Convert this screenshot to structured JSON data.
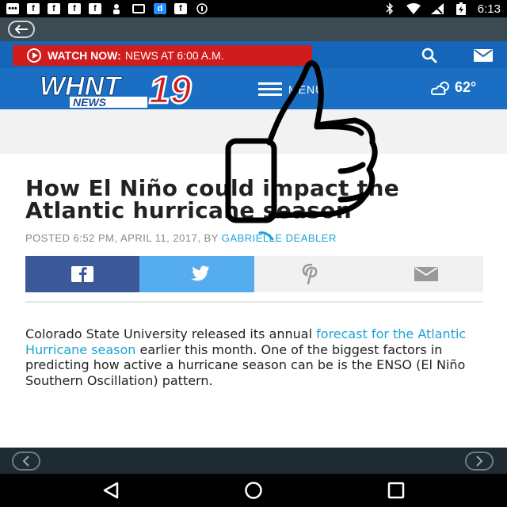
{
  "status_bar": {
    "left_icons": [
      "message-icon",
      "facebook-icon",
      "facebook-icon",
      "facebook-icon",
      "facebook-icon",
      "person-icon",
      "screen-icon",
      "dailymotion-icon",
      "facebook-icon",
      "circle-icon"
    ],
    "time": "6:13"
  },
  "header": {
    "watch_now_label": "WATCH NOW:",
    "watch_now_text": "NEWS AT 6:00 A.M.",
    "menu_label": "MENU",
    "temperature": "62°",
    "logo_text": "WHNT",
    "logo_number": "19",
    "logo_sub": "NEWS"
  },
  "article": {
    "title": "How El Niño could impact the Atlantic hurricane season",
    "posted": "POSTED 6:52 PM, APRIL 11, 2017, BY",
    "author": "GABRIELLE DEABLER",
    "body_before_link": "Colorado State University released its annual ",
    "body_link": "forecast for the Atlantic Hurricane season",
    "body_after_link": " earlier this month. One of the biggest factors in predicting how active a hurricane season can be is the ENSO (El Niño Southern Oscillation) pattern."
  },
  "colors": {
    "header_blue": "#1a6fc4",
    "watch_red": "#d01c1c",
    "facebook": "#3b5998",
    "twitter": "#55acee",
    "link": "#1ca3d6"
  }
}
